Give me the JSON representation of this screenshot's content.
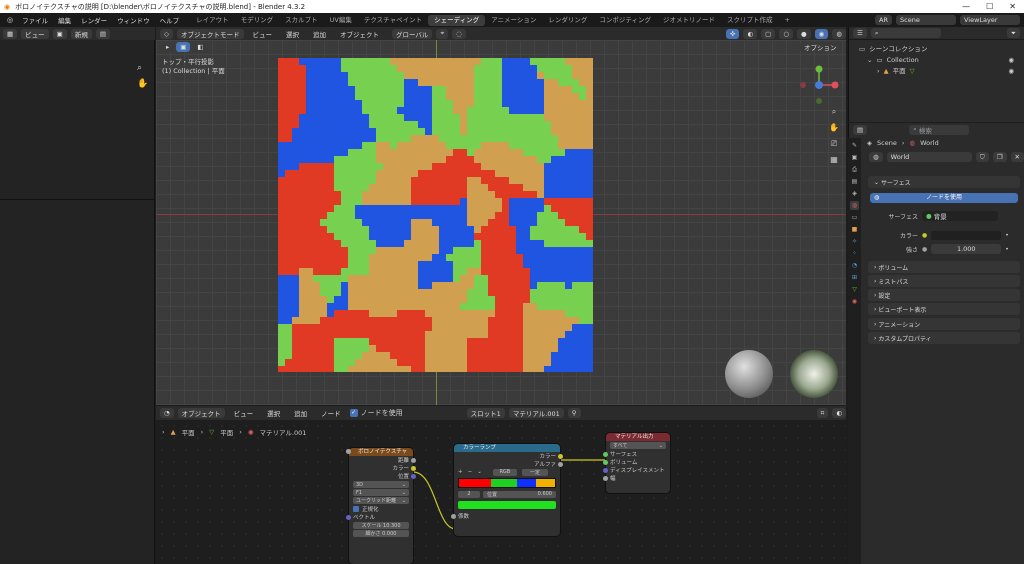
{
  "window_title": "ボロノイテクスチャの説明 [D:\\blender\\ボロノイテクスチャの説明.blend] - Blender 4.3.2",
  "menus": [
    "ファイル",
    "編集",
    "レンダー",
    "ウィンドウ",
    "ヘルプ"
  ],
  "workspaces": [
    {
      "label": "レイアウト",
      "active": false
    },
    {
      "label": "モデリング",
      "active": false
    },
    {
      "label": "スカルプト",
      "active": false
    },
    {
      "label": "UV編集",
      "active": false
    },
    {
      "label": "テクスチャペイント",
      "active": false
    },
    {
      "label": "シェーディング",
      "active": true
    },
    {
      "label": "アニメーション",
      "active": false
    },
    {
      "label": "レンダリング",
      "active": false
    },
    {
      "label": "コンポジティング",
      "active": false
    },
    {
      "label": "ジオメトリノード",
      "active": false
    },
    {
      "label": "スクリプト作成",
      "active": false
    }
  ],
  "add_workspace": "+",
  "topright": {
    "ar": "AR",
    "scene": "Scene",
    "view_layer": "ViewLayer"
  },
  "left_header": {
    "view": "ビュー",
    "new": "新規"
  },
  "viewport": {
    "mode": "オブジェクトモード",
    "menu": [
      "ビュー",
      "選択",
      "追加",
      "オブジェクト"
    ],
    "transform": "グローバル",
    "options": "オプション",
    "view_name": "トップ・平行投影",
    "collection": "(1) Collection | 平面"
  },
  "node_header": {
    "object": "オブジェクト",
    "menu": [
      "ビュー",
      "選択",
      "追加",
      "ノード"
    ],
    "use_nodes": "ノードを使用",
    "slot": "スロット1",
    "material": "マテリアル.001"
  },
  "breadcrumb": [
    "平面",
    "平面",
    "マテリアル.001"
  ],
  "nodes": {
    "voronoi": {
      "title": "ボロノイテクスチャ",
      "outputs": [
        "距離",
        "カラー",
        "位置"
      ],
      "dim": "3D",
      "metric": "F1",
      "distance": "ユークリッド距離",
      "normalize": "正規化",
      "vector": "ベクトル",
      "scale_label": "スケール",
      "scale_value": "10.300",
      "detail_label": "細かさ",
      "detail_value": "0.000"
    },
    "colorramp": {
      "title": "カラーランプ",
      "outputs": [
        "カラー",
        "アルファ"
      ],
      "mode": "RGB",
      "interp": "一定",
      "index": "2",
      "pos_label": "位置",
      "pos_value": "0.600",
      "input": "係数",
      "ctrl": [
        "+",
        "−",
        "⌄"
      ]
    },
    "output": {
      "title": "マテリアル出力",
      "target": "すべて",
      "inputs": [
        "サーフェス",
        "ボリューム",
        "ディスプレイスメント",
        "幅"
      ]
    }
  },
  "outliner": {
    "scene_collection": "シーンコレクション",
    "collection": "Collection",
    "object": "平面"
  },
  "properties": {
    "search_placeholder": "検索",
    "breadcrumb": [
      "Scene",
      "World"
    ],
    "world_name": "World",
    "surface_section": "サーフェス",
    "use_nodes_button": "ノードを使用",
    "surface_label": "サーフェス",
    "surface_value": "背景",
    "color_label": "カラー",
    "strength_label": "強さ",
    "strength_value": "1.000",
    "sections": [
      "ボリューム",
      "ミストパス",
      "設定",
      "ビューポート表示",
      "アニメーション",
      "カスタムプロパティ"
    ]
  },
  "colors": {
    "red": "#e03a24",
    "green": "#78d050",
    "blue": "#1f55e0",
    "tan": "#d0a050",
    "accent": "#4772b3",
    "active_tab": "#3d3d3d"
  }
}
